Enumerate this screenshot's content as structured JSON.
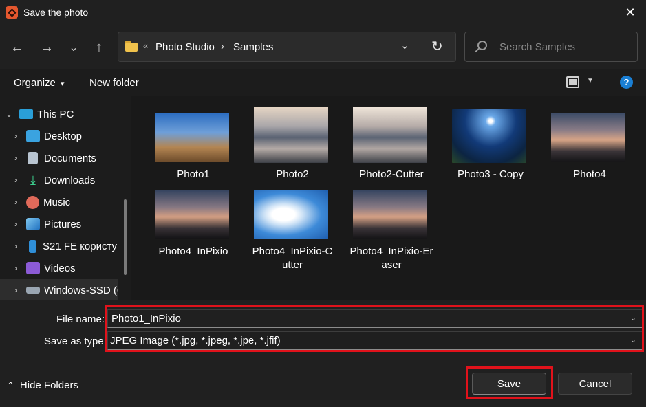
{
  "window": {
    "title": "Save the photo",
    "close_glyph": "✕"
  },
  "nav": {
    "back_glyph": "←",
    "forward_glyph": "→",
    "recent_glyph": "⌄",
    "up_glyph": "↑",
    "breadcrumb_overflow": "«",
    "breadcrumbs": [
      "Photo Studio",
      "Samples"
    ],
    "breadcrumb_separator": "›",
    "dropdown_glyph": "⌄",
    "refresh_glyph": "↻",
    "search_placeholder": "Search Samples"
  },
  "toolbar": {
    "organize_label": "Organize",
    "organize_glyph": "▾",
    "new_folder_label": "New folder",
    "view_dropdown_glyph": "▼",
    "help_glyph": "?"
  },
  "sidebar": {
    "items": [
      {
        "label": "This PC",
        "chevron": "⌄",
        "icon": "monitor-icon"
      },
      {
        "label": "Desktop",
        "chevron": "›",
        "icon": "desktop-icon"
      },
      {
        "label": "Documents",
        "chevron": "›",
        "icon": "documents-icon"
      },
      {
        "label": "Downloads",
        "chevron": "›",
        "icon": "downloads-icon"
      },
      {
        "label": "Music",
        "chevron": "›",
        "icon": "music-icon"
      },
      {
        "label": "Pictures",
        "chevron": "›",
        "icon": "pictures-icon"
      },
      {
        "label": "S21 FE користув",
        "chevron": "›",
        "icon": "phone-icon"
      },
      {
        "label": "Videos",
        "chevron": "›",
        "icon": "videos-icon"
      },
      {
        "label": "Windows-SSD (C",
        "chevron": "›",
        "icon": "drive-icon"
      }
    ]
  },
  "files": [
    {
      "name": "Photo1"
    },
    {
      "name": "Photo2"
    },
    {
      "name": "Photo2-Cutter"
    },
    {
      "name": "Photo3 - Copy"
    },
    {
      "name": "Photo4"
    },
    {
      "name": "Photo4_InPixio"
    },
    {
      "name": "Photo4_InPixio-C\nutter"
    },
    {
      "name": "Photo4_InPixio-Er\naser"
    }
  ],
  "form": {
    "file_name_label": "File name:",
    "file_name_value": "Photo1_InPixio",
    "save_type_label": "Save as type:",
    "save_type_value": "JPEG Image (*.jpg, *.jpeg, *.jpe, *.jfif)",
    "dropdown_glyph": "⌄"
  },
  "footer": {
    "hide_folders_glyph": "⌃",
    "hide_folders_label": "Hide Folders",
    "save_label": "Save",
    "cancel_label": "Cancel"
  }
}
